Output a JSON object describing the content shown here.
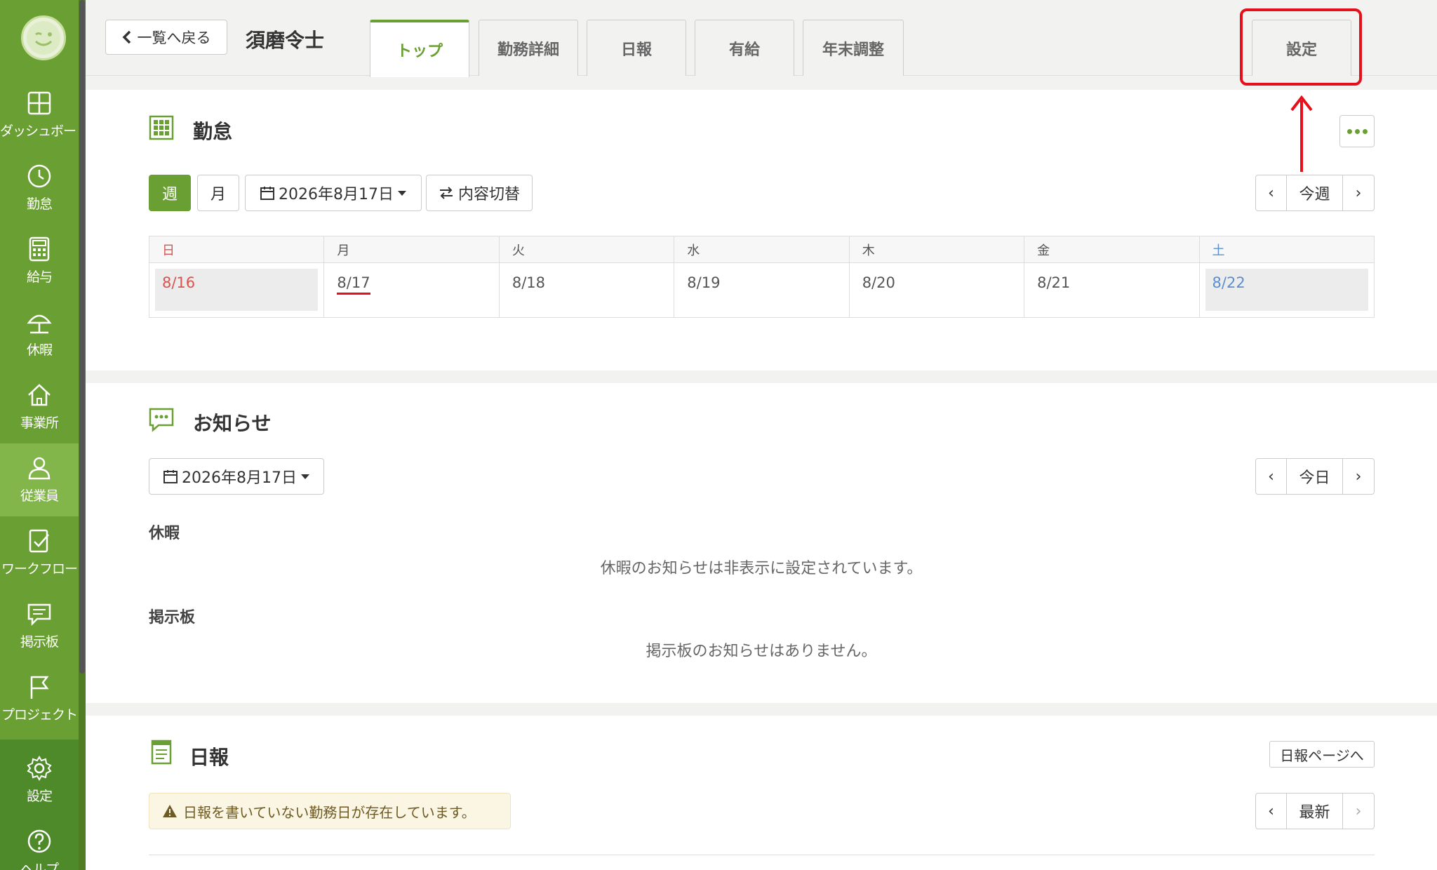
{
  "sidebar": {
    "items": [
      {
        "label": "ダッシュボード",
        "icon": "dashboard-icon"
      },
      {
        "label": "勤怠",
        "icon": "clock-icon"
      },
      {
        "label": "給与",
        "icon": "calculator-icon"
      },
      {
        "label": "休暇",
        "icon": "umbrella-icon"
      },
      {
        "label": "事業所",
        "icon": "home-icon"
      },
      {
        "label": "従業員",
        "icon": "person-icon"
      },
      {
        "label": "ワークフロー",
        "icon": "checklist-icon"
      },
      {
        "label": "掲示板",
        "icon": "message-icon"
      },
      {
        "label": "プロジェクト",
        "icon": "flag-icon"
      },
      {
        "label": "設定",
        "icon": "gear-icon"
      },
      {
        "label": "ヘルプ",
        "icon": "help-icon"
      }
    ]
  },
  "header": {
    "back_label": "一覧へ戻る",
    "employee_name": "須磨令士",
    "tabs": [
      "トップ",
      "勤務詳細",
      "日報",
      "有給",
      "年末調整"
    ],
    "settings_label": "設定"
  },
  "attendance": {
    "title": "勤怠",
    "week_label": "週",
    "month_label": "月",
    "date_label": "2026年8月17日",
    "toggle_label": "内容切替",
    "pager_label": "今週",
    "weekdays": [
      "日",
      "月",
      "火",
      "水",
      "木",
      "金",
      "土"
    ],
    "dates": [
      "8/16",
      "8/17",
      "8/18",
      "8/19",
      "8/20",
      "8/21",
      "8/22"
    ]
  },
  "notices": {
    "title": "お知らせ",
    "date_label": "2026年8月17日",
    "pager_label": "今日",
    "leave_heading": "休暇",
    "leave_message": "休暇のお知らせは非表示に設定されています。",
    "board_heading": "掲示板",
    "board_message": "掲示板のお知らせはありません。"
  },
  "daily_report": {
    "title": "日報",
    "page_link_label": "日報ページへ",
    "warning": "日報を書いていない勤務日が存在しています。",
    "pager_label": "最新"
  },
  "colors": {
    "brand_green": "#6aa033",
    "highlight_red": "#e5101b"
  }
}
